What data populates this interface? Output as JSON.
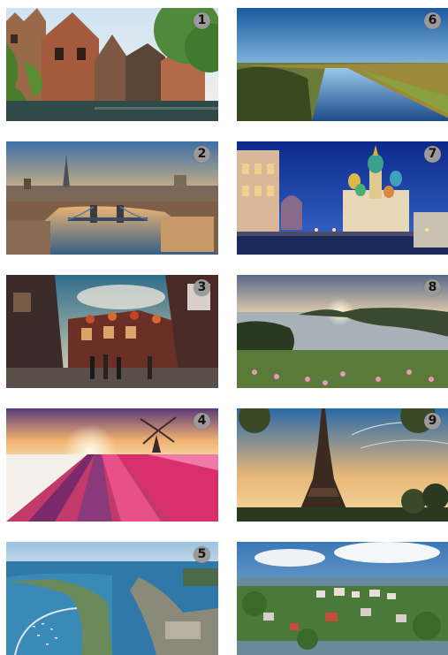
{
  "gallery": {
    "tiles": [
      {
        "badge": "1",
        "icon": "canal-town-photo"
      },
      {
        "badge": "2",
        "icon": "city-bridge-photo"
      },
      {
        "badge": "3",
        "icon": "pub-street-photo"
      },
      {
        "badge": "4",
        "icon": "tulip-windmill-photo"
      },
      {
        "badge": "5",
        "icon": "harbor-aerial-photo"
      },
      {
        "badge": "6",
        "icon": "river-valley-photo"
      },
      {
        "badge": "7",
        "icon": "cathedral-night-photo"
      },
      {
        "badge": "8",
        "icon": "coast-sunset-photo"
      },
      {
        "badge": "9",
        "icon": "eiffel-tower-photo"
      },
      {
        "badge": "",
        "icon": "hillside-city-photo"
      }
    ]
  },
  "colors": {
    "badge_bg": "#9a9a9a",
    "badge_text": "#141414"
  }
}
